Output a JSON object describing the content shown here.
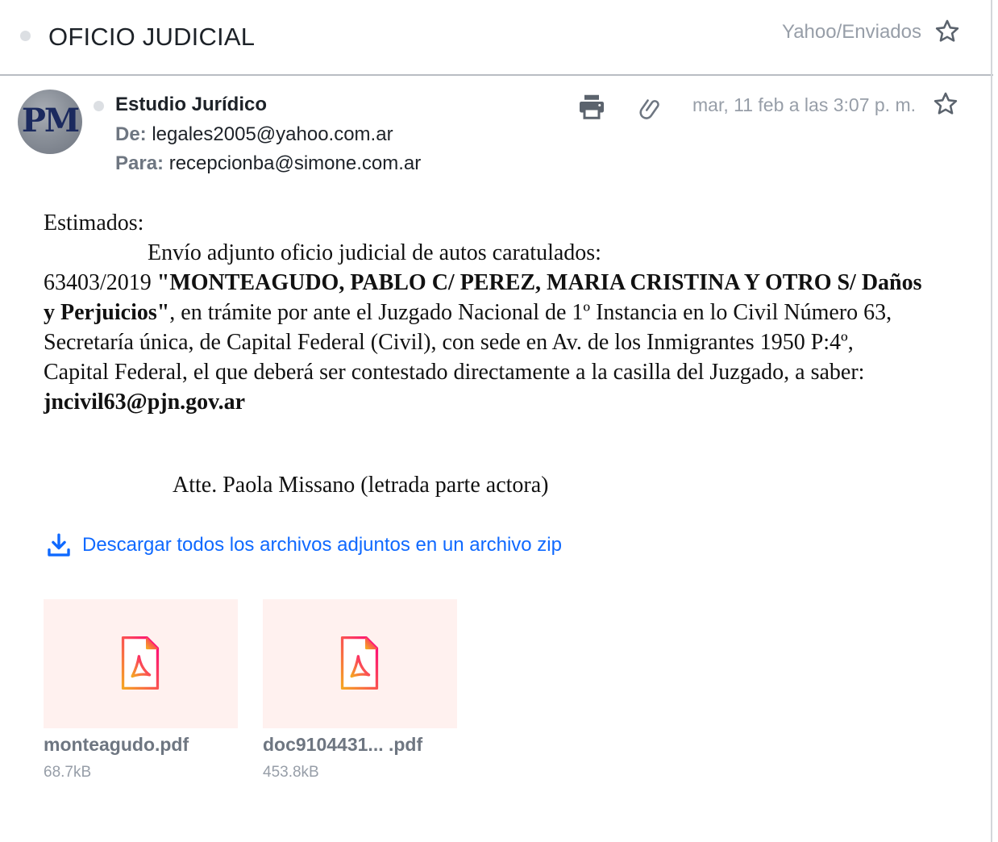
{
  "header": {
    "subject": "OFICIO JUDICIAL",
    "folder": "Yahoo/Enviados"
  },
  "message": {
    "avatar_initials": "PM",
    "sender_name": "Estudio Jurídico",
    "from_label": "De:",
    "from_value": "legales2005@yahoo.com.ar",
    "to_label": "Para:",
    "to_value": "recepcionba@simone.com.ar",
    "date": "mar, 11 feb a las 3:07 p. m."
  },
  "body": {
    "greeting": "Estimados:",
    "intro": "Envío adjunto oficio judicial de autos caratulados:",
    "case_number": "63403/2019 ",
    "case_title": "\"MONTEAGUDO, PABLO C/ PEREZ, MARIA CRISTINA Y OTRO S/ Daños y Perjuicios\"",
    "case_rest": ", en trámite por ante el Juzgado Nacional de 1º Instancia en lo Civil Número 63, Secretaría única, de Capital Federal (Civil), con sede en Av. de los Inmigrantes 1950 P:4º, Capital Federal, el que deberá ser contestado directamente a la casilla del Juzgado, a saber:",
    "court_email": "jncivil63@pjn.gov.ar",
    "signature": "Atte. Paola Missano (letrada parte actora)"
  },
  "attachments": {
    "download_all_label": "Descargar todos los archivos adjuntos en un archivo zip",
    "files": [
      {
        "name": "monteagudo.pdf",
        "size": "68.7kB",
        "icon": "pdf-icon"
      },
      {
        "name": "doc9104431...  .pdf",
        "size": "453.8kB",
        "icon": "pdf-icon"
      }
    ]
  },
  "colors": {
    "accent_link": "#0f69ff",
    "muted_text": "#979ea8",
    "attachment_bg": "#fff1ef",
    "pdf_gradient_start": "#f5a623",
    "pdf_gradient_end": "#ff0080"
  }
}
